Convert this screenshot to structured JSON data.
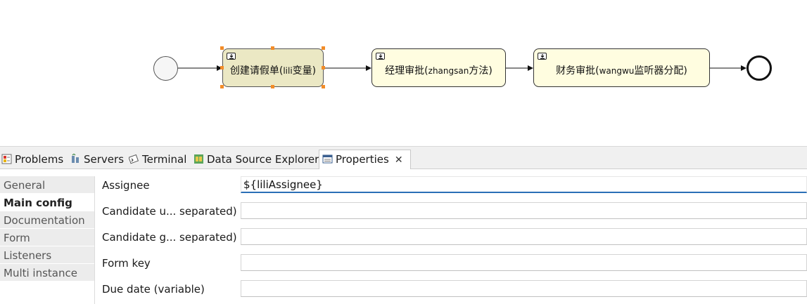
{
  "diagram": {
    "tasks": [
      {
        "label_main": "创建请假单(",
        "label_small": "lili",
        "label_end": "变量)"
      },
      {
        "label_main": "经理审批(",
        "label_small": "zhangsan",
        "label_end": "方法)"
      },
      {
        "label_main": "财务审批(",
        "label_small": "wangwu",
        "label_end": "监听器分配)"
      }
    ]
  },
  "tabs": [
    {
      "label": "Problems",
      "icon": "problems-icon"
    },
    {
      "label": "Servers",
      "icon": "servers-icon"
    },
    {
      "label": "Terminal",
      "icon": "terminal-icon"
    },
    {
      "label": "Data Source Explorer",
      "icon": "data-source-explorer-icon"
    },
    {
      "label": "Properties",
      "icon": "properties-icon",
      "active": true
    }
  ],
  "nav": {
    "items": [
      "General",
      "Main config",
      "Documentation",
      "Form",
      "Listeners",
      "Multi instance"
    ],
    "active": "Main config"
  },
  "fields": [
    {
      "label": "Assignee",
      "value": "${liliAssignee}"
    },
    {
      "label": "Candidate u... separated)",
      "value": ""
    },
    {
      "label": "Candidate g... separated)",
      "value": ""
    },
    {
      "label": "Form key",
      "value": ""
    },
    {
      "label": "Due date (variable)",
      "value": ""
    }
  ],
  "colors": {
    "task_fill": "#fffde0",
    "selected_task_fill": "#ebe8c4",
    "selection_handle": "#f28c28",
    "focus_underline": "#2a6fb6"
  }
}
